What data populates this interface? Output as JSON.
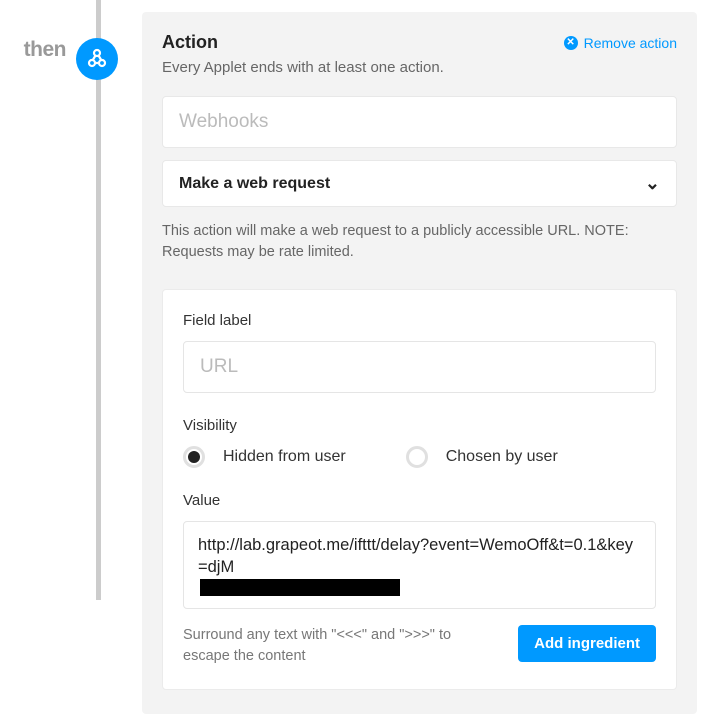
{
  "then_label": "then",
  "header": {
    "title": "Action",
    "remove": "Remove action",
    "subtitle": "Every Applet ends with at least one action."
  },
  "service_placeholder": "Webhooks",
  "action_select": "Make a web request",
  "action_desc": "This action will make a web request to a publicly accessible URL. NOTE: Requests may be rate limited.",
  "field": {
    "label_title": "Field label",
    "url_placeholder": "URL",
    "visibility_title": "Visibility",
    "vis_hidden": "Hidden from user",
    "vis_chosen": "Chosen by user",
    "value_title": "Value",
    "value_text": "http://lab.grapeot.me/ifttt/delay?event=WemoOff&t=0.1&key=djM",
    "hint": "Surround any text with \"<<<\" and \">>>\" to escape the content",
    "add_btn": "Add ingredient"
  }
}
